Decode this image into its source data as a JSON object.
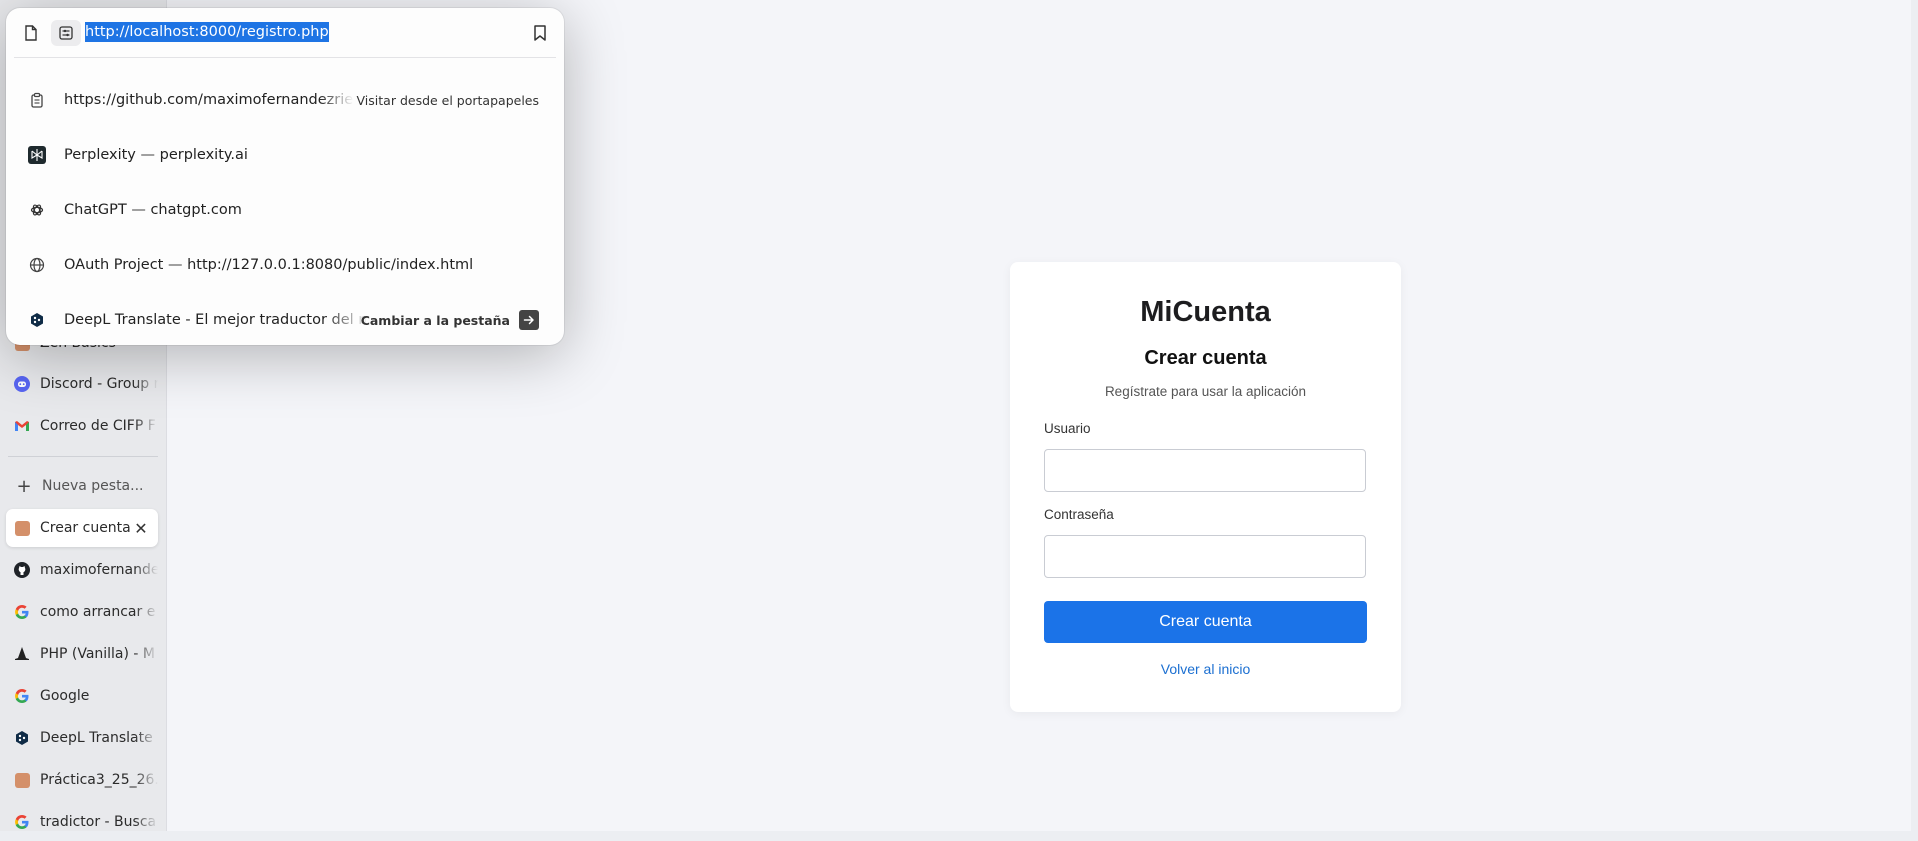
{
  "address_bar": {
    "url": "http://localhost:8000/registro.php"
  },
  "suggestions": [
    {
      "icon": "clipboard-icon",
      "title": "https://github.com/maximofernandezrien",
      "separator": "",
      "domain": "",
      "action": "Visitar desde el portapapeles"
    },
    {
      "icon": "perplexity-icon",
      "title": "Perplexity",
      "separator": "—",
      "domain": "perplexity.ai",
      "action": ""
    },
    {
      "icon": "chatgpt-icon",
      "title": "ChatGPT",
      "separator": "—",
      "domain": "chatgpt.com",
      "action": ""
    },
    {
      "icon": "globe-icon",
      "title": "OAuth Project",
      "separator": "—",
      "domain": "http://127.0.0.1:8080/public/index.html",
      "action": ""
    },
    {
      "icon": "deepl-icon",
      "title": "DeepL Translate - El mejor traductor del mu",
      "separator": "",
      "domain": "",
      "action": "Cambiar a la pestaña"
    }
  ],
  "sidebar": {
    "pinned": [
      {
        "label": "Zen Basics",
        "icon": "zen-icon"
      },
      {
        "label": "Discord - Group r",
        "icon": "discord-icon"
      },
      {
        "label": "Correo de CIFP F",
        "icon": "gmail-icon"
      }
    ],
    "new_tab_label": "Nueva pesta...",
    "active_tab": {
      "label": "Crear cuenta",
      "icon": "page-icon"
    },
    "tabs": [
      {
        "label": "maximofernande",
        "icon": "github-icon"
      },
      {
        "label": "como arrancar e",
        "icon": "google-icon"
      },
      {
        "label": "PHP (Vanilla) - M",
        "icon": "wizard-hat-icon"
      },
      {
        "label": "Google",
        "icon": "google-icon"
      },
      {
        "label": "DeepL Translate",
        "icon": "deepl-icon"
      },
      {
        "label": "Práctica3_25_26.",
        "icon": "page-icon"
      },
      {
        "label": "tradictor - Busca",
        "icon": "google-icon"
      }
    ]
  },
  "card": {
    "brand": "MiCuenta",
    "title": "Crear cuenta",
    "subtitle": "Regístrate para usar la aplicación",
    "username_label": "Usuario",
    "username_value": "",
    "password_label": "Contraseña",
    "password_value": "",
    "submit_label": "Crear cuenta",
    "back_link": "Volver al inicio"
  },
  "colors": {
    "accent": "#1b73e8",
    "link": "#1b6fd1",
    "url_highlight": "#1e74e4",
    "page_background": "#f4f5f9",
    "tab_favicon": "#d4906a"
  }
}
